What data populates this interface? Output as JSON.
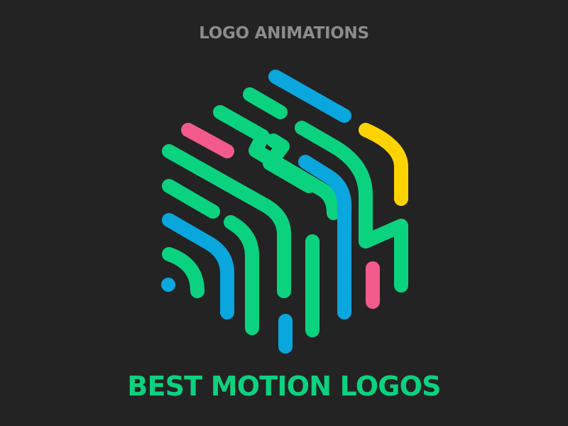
{
  "header": {
    "title": "LOGO ANIMATIONS"
  },
  "footer": {
    "title": "BEST MOTION LOGOS"
  },
  "colors": {
    "background": "#232323",
    "green": "#0bd27f",
    "blue": "#0aa6de",
    "pink": "#f25a8c",
    "yellow": "#ffd300",
    "header_text": "#8c8c8c"
  },
  "logo": {
    "name": "maze-cube-logo"
  }
}
